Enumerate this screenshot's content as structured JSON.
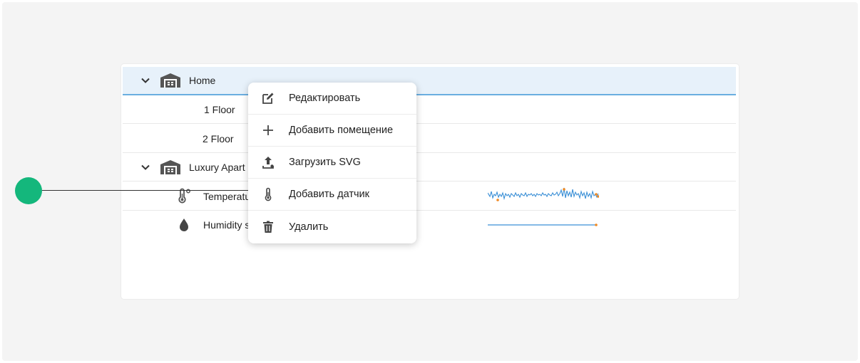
{
  "tree": {
    "rows": [
      {
        "label": "Home",
        "type": "building",
        "expanded": true,
        "selected": true
      },
      {
        "label": "1 Floor",
        "type": "room"
      },
      {
        "label": "2 Floor",
        "type": "room"
      },
      {
        "label": "Luxury Apart",
        "type": "building",
        "expanded": true
      },
      {
        "label": "Temperatu",
        "type": "sensor",
        "icon": "thermometer-icon"
      },
      {
        "label": "Humidity s",
        "type": "sensor",
        "icon": "water-drop-icon"
      }
    ]
  },
  "context_menu": {
    "items": [
      {
        "label": "Редактировать",
        "icon": "edit-icon"
      },
      {
        "label": "Добавить помещение",
        "icon": "plus-icon"
      },
      {
        "label": "Загрузить SVG",
        "icon": "upload-icon"
      },
      {
        "label": "Добавить датчик",
        "icon": "thermometer-icon"
      },
      {
        "label": "Удалить",
        "icon": "trash-icon"
      }
    ]
  },
  "colors": {
    "selected_row_bg": "#e7f1fa",
    "selected_row_border": "#6aaee0",
    "sparkline_line": "#3a8fd6",
    "sparkline_marker": "#f08a24",
    "annotation_dot": "#14b77c",
    "icon_gray": "#555555"
  }
}
